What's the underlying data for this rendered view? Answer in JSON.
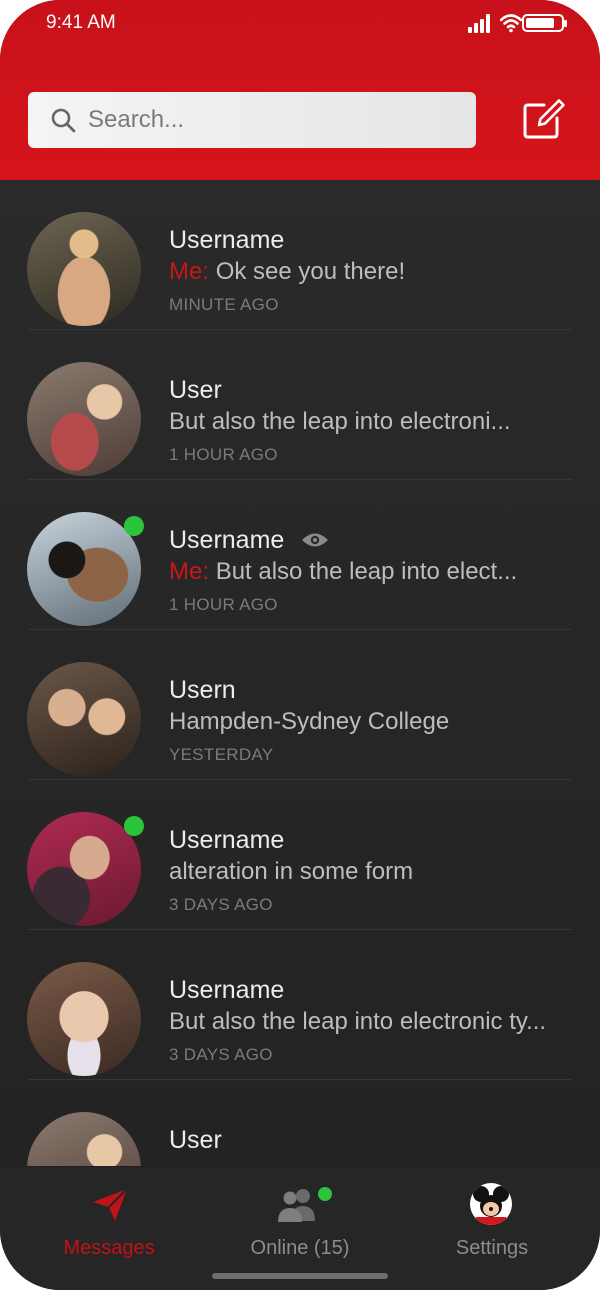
{
  "status_bar": {
    "time": "9:41 AM"
  },
  "search": {
    "placeholder": "Search..."
  },
  "colors": {
    "brand_red": "#d6151b",
    "online_green": "#2cc43b",
    "me_prefix": "#c8161c"
  },
  "conversations": [
    {
      "username": "Username",
      "me_prefix": "Me:",
      "message": "Ok see you there!",
      "time": "MINUTE AGO",
      "online": false,
      "seen_icon": false
    },
    {
      "username": "User",
      "me_prefix": "",
      "message": "But also the leap into electroni...",
      "time": "1 HOUR AGO",
      "online": false,
      "seen_icon": false
    },
    {
      "username": "Username",
      "me_prefix": "Me:",
      "message": "But also the leap into elect...",
      "time": "1 HOUR AGO",
      "online": true,
      "seen_icon": true
    },
    {
      "username": "Usern",
      "me_prefix": "",
      "message": "Hampden-Sydney College",
      "time": "YESTERDAY",
      "online": false,
      "seen_icon": false
    },
    {
      "username": "Username",
      "me_prefix": "",
      "message": "alteration in some form",
      "time": "3 DAYS AGO",
      "online": true,
      "seen_icon": false
    },
    {
      "username": "Username",
      "me_prefix": "",
      "message": "But also the leap into electronic ty...",
      "time": "3 DAYS AGO",
      "online": false,
      "seen_icon": false
    },
    {
      "username": "User",
      "me_prefix": "",
      "message": "",
      "time": "",
      "online": false,
      "seen_icon": false
    }
  ],
  "tabs": [
    {
      "label": "Messages",
      "icon": "paper-plane-icon",
      "active": true
    },
    {
      "label": "Online (15)",
      "icon": "users-icon",
      "active": false
    },
    {
      "label": "Settings",
      "icon": "profile-avatar-icon",
      "active": false
    }
  ]
}
